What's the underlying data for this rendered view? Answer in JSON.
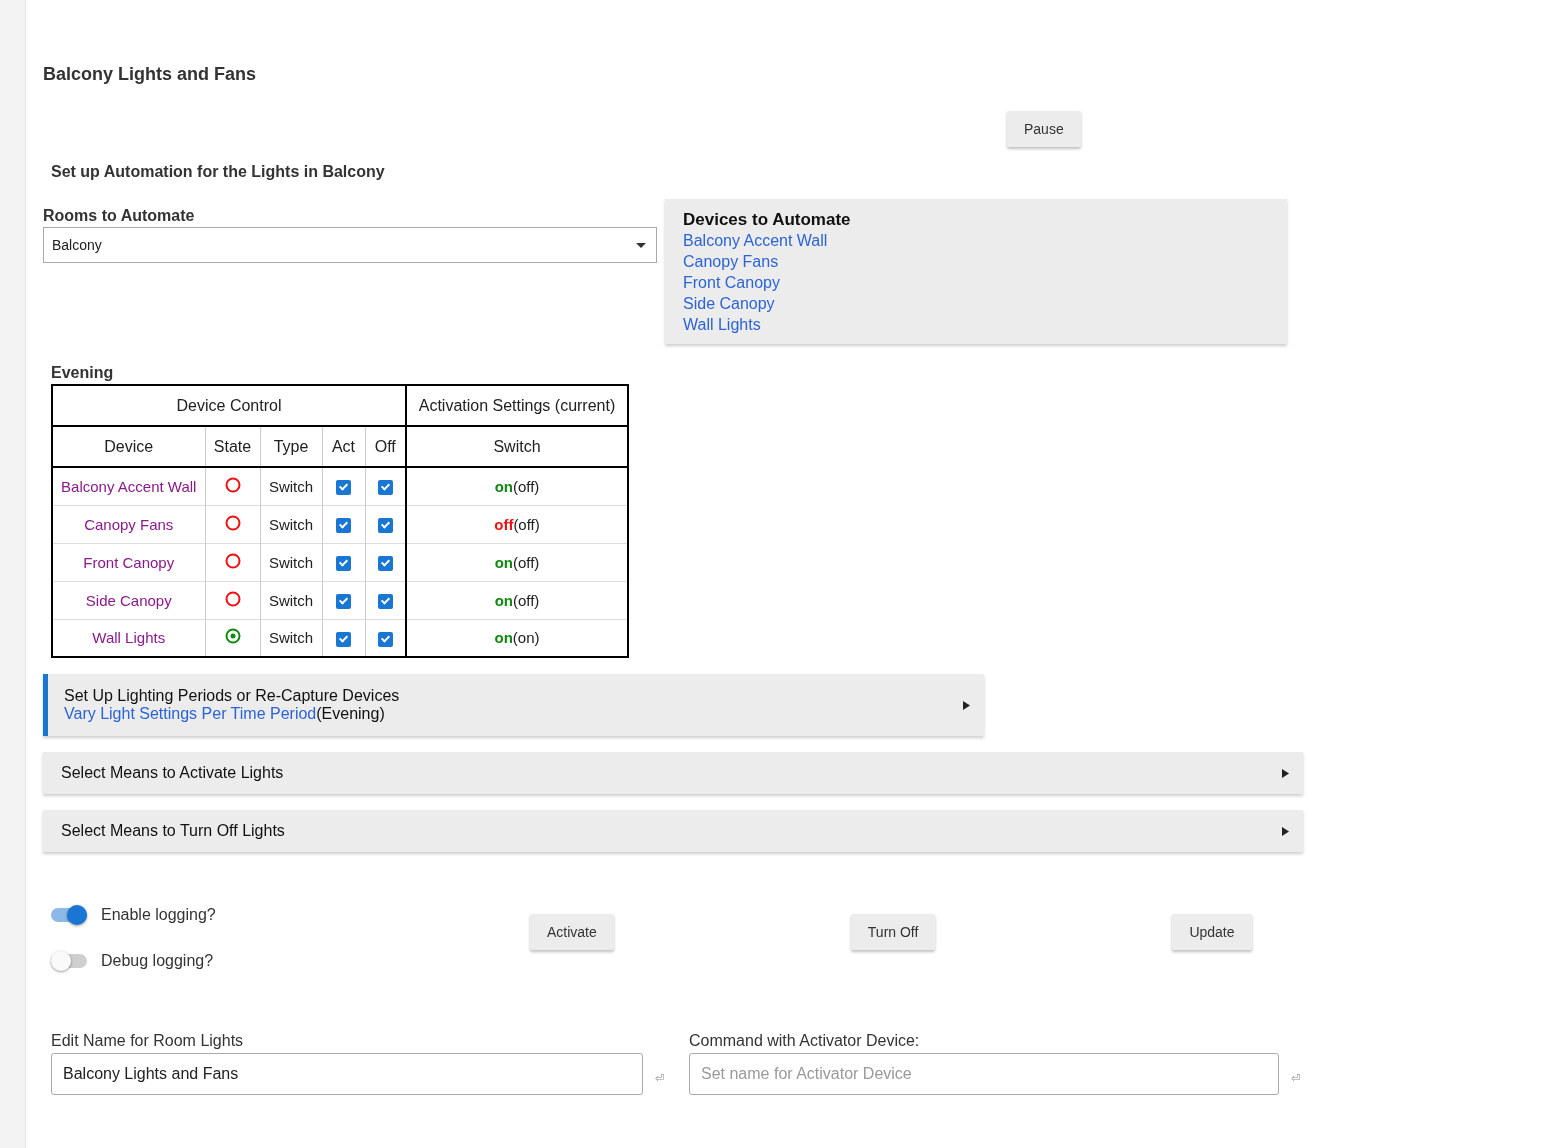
{
  "title": "Balcony Lights and Fans",
  "pause_button": "Pause",
  "subtitle": "Set up Automation for the Lights in Balcony",
  "rooms": {
    "label": "Rooms to Automate",
    "value": "Balcony"
  },
  "devices_panel": {
    "title": "Devices to Automate",
    "links": [
      "Balcony Accent Wall",
      "Canopy Fans",
      "Front Canopy",
      "Side Canopy",
      "Wall Lights"
    ]
  },
  "period_label": "Evening",
  "table": {
    "group_headers": [
      "Device Control",
      "Activation Settings (current)"
    ],
    "columns": [
      "Device",
      "State",
      "Type",
      "Act",
      "Off",
      "Switch"
    ],
    "rows": [
      {
        "device": "Balcony Accent Wall",
        "on": false,
        "type": "Switch",
        "act": true,
        "off": true,
        "setting": "on",
        "setting_on": true,
        "current": "(off)"
      },
      {
        "device": "Canopy Fans",
        "on": false,
        "type": "Switch",
        "act": true,
        "off": true,
        "setting": "off",
        "setting_on": false,
        "current": "(off)"
      },
      {
        "device": "Front Canopy",
        "on": false,
        "type": "Switch",
        "act": true,
        "off": true,
        "setting": "on",
        "setting_on": true,
        "current": "(off)"
      },
      {
        "device": "Side Canopy",
        "on": false,
        "type": "Switch",
        "act": true,
        "off": true,
        "setting": "on",
        "setting_on": true,
        "current": "(off)"
      },
      {
        "device": "Wall Lights",
        "on": true,
        "type": "Switch",
        "act": true,
        "off": true,
        "setting": "on",
        "setting_on": true,
        "current": "(on)"
      }
    ]
  },
  "sections": [
    {
      "title": "Set Up Lighting Periods or Re-Capture Devices",
      "link": "Vary Light Settings Per Time Period",
      "suffix": "(Evening)",
      "highlighted": true
    },
    {
      "title": "Select Means to Activate Lights",
      "highlighted": false
    },
    {
      "title": "Select Means to Turn Off Lights",
      "highlighted": false
    }
  ],
  "toggles": [
    {
      "label": "Enable logging?",
      "on": true
    },
    {
      "label": "Debug logging?",
      "on": false
    }
  ],
  "action_buttons": [
    "Activate",
    "Turn Off",
    "Update"
  ],
  "fields": [
    {
      "label": "Edit Name for Room Lights",
      "value": "Balcony Lights and Fans",
      "enter_mark": "⏎"
    },
    {
      "label": "Command with Activator Device:",
      "placeholder": "Set name for Activator Device",
      "enter_mark": "⏎"
    }
  ]
}
